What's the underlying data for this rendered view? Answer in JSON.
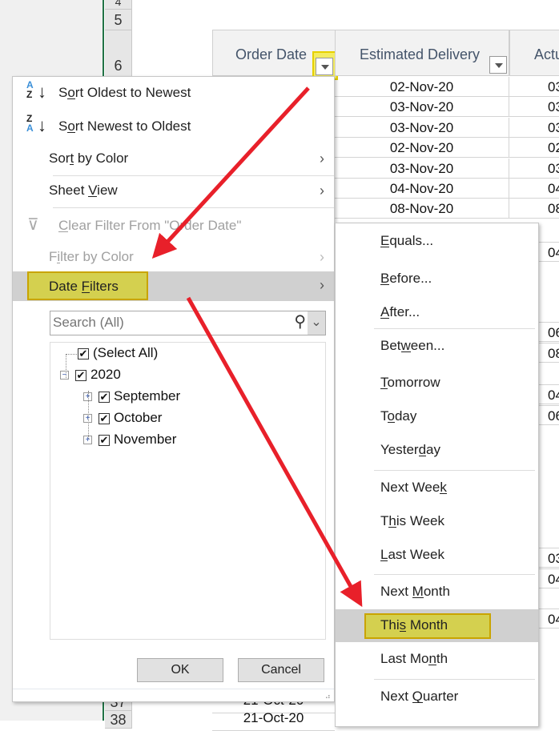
{
  "sheet": {
    "row_numbers_top": [
      "4",
      "5",
      "6"
    ],
    "row_numbers_bottom": [
      "37",
      "38"
    ],
    "headers": [
      "Order Date",
      "Estimated Delivery",
      "Actu"
    ],
    "estimated_delivery": [
      "02-Nov-20",
      "03-Nov-20",
      "03-Nov-20",
      "02-Nov-20",
      "03-Nov-20",
      "04-Nov-20",
      "08-Nov-20"
    ],
    "actual_partial": [
      "03",
      "03",
      "03",
      "02",
      "03",
      "04",
      "08"
    ],
    "actual_partial_right": [
      "04",
      "06",
      "08",
      "04",
      "06",
      "03",
      "04",
      "04"
    ],
    "bottom_order_dates": [
      "21-Oct-20",
      "21-Oct-20"
    ]
  },
  "menu": {
    "sort_asc": {
      "label": "Sort Oldest to Newest",
      "key": 1,
      "icon": "sort-a-z-icon"
    },
    "sort_desc": {
      "label": "Sort Newest to Oldest",
      "key": 1,
      "icon": "sort-z-a-icon"
    },
    "sort_color": {
      "label": "Sort by Color",
      "key": 3
    },
    "sheet_view": {
      "label": "Sheet View",
      "key": 6
    },
    "clear_filter": {
      "label": "Clear Filter From \"Order Date\"",
      "key": 0,
      "icon": "clear-filter-icon",
      "disabled": true
    },
    "filter_color": {
      "label": "Filter by Color",
      "key": 1,
      "disabled": true
    },
    "date_filters": {
      "label": "Date Filters",
      "key": 5
    },
    "search_placeholder": "Search (All)",
    "tree": [
      {
        "label": "(Select All)",
        "checked": true
      },
      {
        "label": "2020",
        "checked": true,
        "expanded": true
      },
      {
        "label": "September",
        "checked": true
      },
      {
        "label": "October",
        "checked": true
      },
      {
        "label": "November",
        "checked": true
      }
    ],
    "ok": "OK",
    "cancel": "Cancel"
  },
  "submenu": [
    {
      "label": "Equals...",
      "key": 0
    },
    {
      "label": "Before...",
      "key": 0
    },
    {
      "label": "After...",
      "key": 0
    },
    {
      "label": "Between...",
      "key": 3
    },
    {
      "label": "Tomorrow",
      "key": 0
    },
    {
      "label": "Today",
      "key": 1
    },
    {
      "label": "Yesterday",
      "key": 6
    },
    {
      "label": "Next Week",
      "key": 8
    },
    {
      "label": "This Week",
      "key": 1
    },
    {
      "label": "Last Week",
      "key": 0
    },
    {
      "label": "Next Month",
      "key": 5
    },
    {
      "label": "This Month",
      "key": 3,
      "highlighted": true
    },
    {
      "label": "Last Month",
      "key": 7
    },
    {
      "label": "Next Quarter",
      "key": 5
    }
  ],
  "colors": {
    "highlight": "#d4d04f",
    "arrow": "#e8202a",
    "grid_accent": "#217346"
  }
}
